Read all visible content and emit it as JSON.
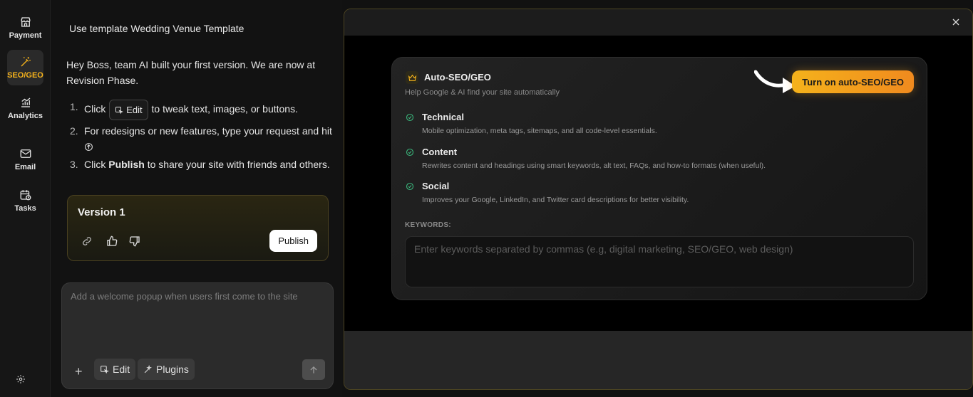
{
  "rail": {
    "items": [
      {
        "label": "Payment"
      },
      {
        "label": "SEO/GEO"
      },
      {
        "label": "Analytics"
      },
      {
        "label": "Email"
      },
      {
        "label": "Tasks"
      }
    ],
    "active": "SEO/GEO",
    "accent": "#f5b21b"
  },
  "chat": {
    "template_line": "Use template Wedding Venue Template",
    "intro": "Hey Boss, team AI built your first version. We are now at Revision Phase.",
    "steps": {
      "s1_pre": "Click",
      "s1_chip": "Edit",
      "s1_post": "to tweak text, images, or buttons.",
      "s2_a": "For redesigns or new features, type your request and hit",
      "s3_pre": "Click",
      "s3_bold": "Publish",
      "s3_post": "to share your site with friends and others."
    },
    "nums": [
      "1.",
      "2.",
      "3."
    ],
    "version": {
      "title": "Version 1",
      "publish_label": "Publish"
    },
    "composer": {
      "placeholder": "Add a welcome popup when users first come to the site",
      "edit_label": "Edit",
      "plugins_label": "Plugins"
    }
  },
  "modal": {
    "card": {
      "title": "Auto-SEO/GEO",
      "subtitle": "Help Google & AI find your site automatically",
      "cta": "Turn on auto-SEO/GEO",
      "features": [
        {
          "title": "Technical",
          "desc": "Mobile optimization, meta tags, sitemaps, and all code-level essentials."
        },
        {
          "title": "Content",
          "desc": "Rewrites content and headings using smart keywords, alt text, FAQs, and how-to formats (when useful)."
        },
        {
          "title": "Social",
          "desc": "Improves your Google, LinkedIn, and Twitter card descriptions for better visibility."
        }
      ],
      "keywords_label": "KEYWORDS:",
      "keywords_placeholder": "Enter keywords separated by commas (e.g, digital marketing, SEO/GEO, web design)"
    },
    "check_color": "#3ab37a"
  }
}
